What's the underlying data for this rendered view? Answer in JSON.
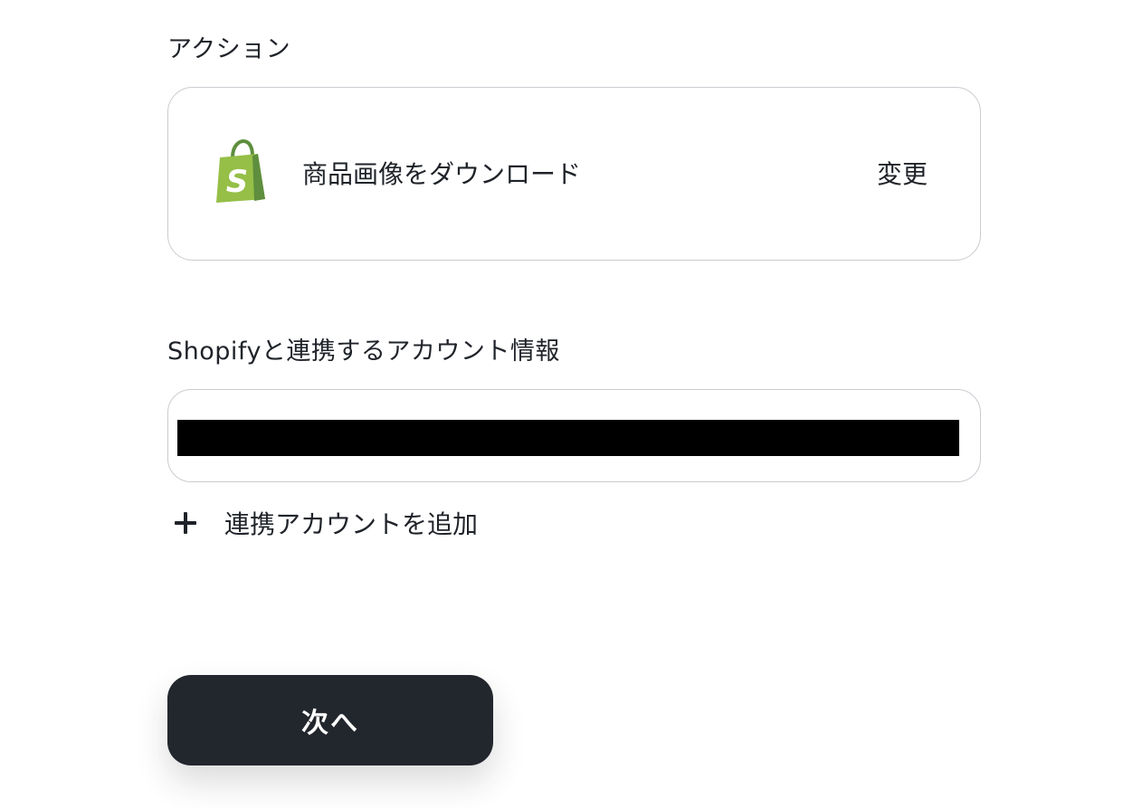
{
  "action": {
    "section_label": "アクション",
    "app_icon": "shopify-bag-icon",
    "action_name": "商品画像をダウンロード",
    "change_label": "変更"
  },
  "account": {
    "section_label": "Shopifyと連携するアカウント情報",
    "selected_value": "",
    "add_account_label": "連携アカウントを追加",
    "add_icon": "plus-icon"
  },
  "footer": {
    "next_label": "次へ"
  },
  "colors": {
    "shopify_green": "#95BF47",
    "shopify_dark_green": "#5E8E3E",
    "button_background": "#22262D",
    "border": "#C9CCD1",
    "redaction": "#000000"
  }
}
